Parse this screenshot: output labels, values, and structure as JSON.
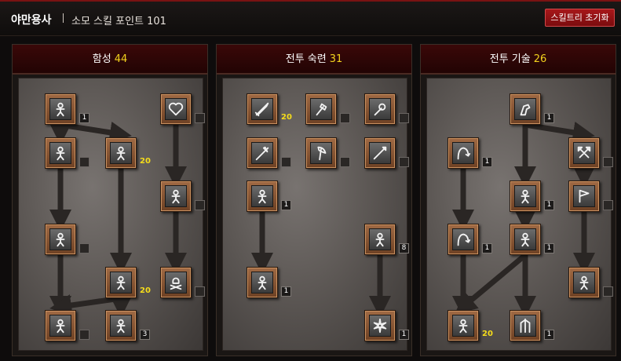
{
  "header": {
    "class_name": "야만용사",
    "skill_points_label": "소모 스킬 포인트 101",
    "reset_button": "스킬트리 초기화"
  },
  "colors": {
    "points": "#f3d21d",
    "header_red": "#7a1212"
  },
  "trees": [
    {
      "name": "함성",
      "points": "44",
      "skills": [
        {
          "icon": "shout-icon",
          "level": "1"
        },
        {
          "icon": "howl-icon",
          "level": ""
        },
        {
          "icon": "battle-cry-icon",
          "level": "20"
        },
        {
          "icon": "heart-cross-icon",
          "level": ""
        },
        {
          "icon": "shout-arc-icon",
          "level": ""
        },
        {
          "icon": "warcry-icon",
          "level": ""
        },
        {
          "icon": "battle-orders-icon",
          "level": "20"
        },
        {
          "icon": "skull-crossbones-icon",
          "level": ""
        },
        {
          "icon": "stun-icon",
          "level": ""
        },
        {
          "icon": "battle-command-icon",
          "level": "3"
        }
      ]
    },
    {
      "name": "전투 숙련",
      "points": "31",
      "skills": [
        {
          "icon": "sword-icon",
          "level": "20"
        },
        {
          "icon": "axe-icon",
          "level": ""
        },
        {
          "icon": "mace-icon",
          "level": ""
        },
        {
          "icon": "polearm-icon",
          "level": ""
        },
        {
          "icon": "battle-axe-icon",
          "level": ""
        },
        {
          "icon": "spear-icon",
          "level": ""
        },
        {
          "icon": "running-man-icon",
          "level": "1"
        },
        {
          "icon": "kick-icon",
          "level": "8"
        },
        {
          "icon": "dash-icon",
          "level": "1"
        },
        {
          "icon": "burst-icon",
          "level": "1"
        }
      ]
    },
    {
      "name": "전투 기술",
      "points": "26",
      "skills": [
        {
          "icon": "fist-icon",
          "level": "1"
        },
        {
          "icon": "leap-icon",
          "level": "1"
        },
        {
          "icon": "double-axe-icon",
          "level": ""
        },
        {
          "icon": "concentrate-icon",
          "level": "1"
        },
        {
          "icon": "flag-icon",
          "level": ""
        },
        {
          "icon": "leap-attack-icon",
          "level": "1"
        },
        {
          "icon": "frenzy-icon",
          "level": "1"
        },
        {
          "icon": "whirlwind-axe-icon",
          "level": ""
        },
        {
          "icon": "multi-strike-icon",
          "level": "20"
        },
        {
          "icon": "berserk-icon",
          "level": "1"
        }
      ]
    }
  ]
}
